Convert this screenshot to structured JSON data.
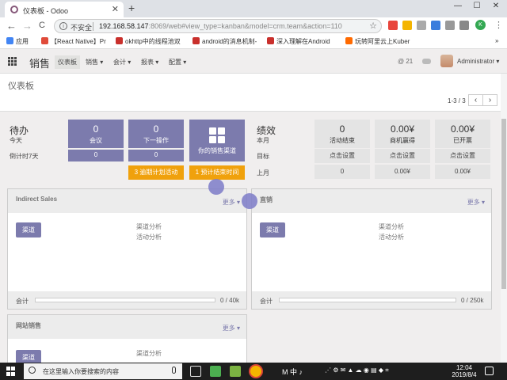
{
  "browser": {
    "tab_title": "仪表板 - Odoo",
    "tab_close": "✕",
    "new_tab": "+",
    "window_controls": [
      "—",
      "☐",
      "✕"
    ],
    "insecure_label": "不安全",
    "url_host": "192.168.58.147",
    "url_rest": ":8069/web#view_type=kanban&model=crm.team&action=110",
    "nav": {
      "back": "←",
      "forward": "→",
      "reload": "C"
    },
    "star": "☆",
    "profile_initial": "K",
    "menu_dots": "⋮",
    "bookmarks": [
      {
        "label": "应用",
        "color": "#4285f4"
      },
      {
        "label": "【React Native】Pr",
        "color": "#e04b3a"
      },
      {
        "label": "okhttp中的线程池双",
        "color": "#c9302c"
      },
      {
        "label": "android的消息机制-",
        "color": "#c9302c"
      },
      {
        "label": "深入理解在Android",
        "color": "#c9302c"
      },
      {
        "label": "玩转阿里云上Kuber",
        "color": "#ff6a00"
      }
    ],
    "bookmarks_more": "»"
  },
  "odoo": {
    "app_name": "销售",
    "menus": [
      {
        "label": "仪表板",
        "active": true
      },
      {
        "label": "销售 ▾",
        "active": false
      },
      {
        "label": "会计 ▾",
        "active": false
      },
      {
        "label": "报表 ▾",
        "active": false
      },
      {
        "label": "配置 ▾",
        "active": false
      }
    ],
    "messages": "@ 21",
    "user": "Administrator ▾"
  },
  "control_panel": {
    "breadcrumb": "仪表板",
    "pager": "1-3 / 3",
    "prev": "‹",
    "next": "›"
  },
  "dashboard": {
    "todo": {
      "title": "待办",
      "today": "今天",
      "next7": "倒计时7天",
      "meetings": {
        "num": "0",
        "label": "会议",
        "sub": "0"
      },
      "next_actions": {
        "num": "0",
        "label": "下一操作",
        "sub": "0"
      },
      "pipeline": {
        "label": "你的销售渠道"
      },
      "overdue_actions": "3 逾期计划活动",
      "overdue_close": "1 预计结束时间"
    },
    "performance": {
      "title": "绩效",
      "this_month": "本月",
      "target": "目标",
      "last_month": "上月",
      "columns": [
        {
          "num": "0",
          "label": "活动结束",
          "target": "点击设置",
          "last": "0"
        },
        {
          "num": "0.00¥",
          "label": "商机赢得",
          "target": "点击设置",
          "last": "0.00¥"
        },
        {
          "num": "0.00¥",
          "label": "已开票",
          "target": "点击设置",
          "last": "0.00¥"
        }
      ]
    }
  },
  "teams": [
    {
      "name": "Indirect Sales",
      "more": "更多 ▾",
      "button": "渠道",
      "links": [
        "渠道分析",
        "活动分析"
      ],
      "invoiced_label": "会计",
      "progress_text": "0 / 40k",
      "progress": 0
    },
    {
      "name": "直销",
      "more": "更多 ▾",
      "button": "渠道",
      "links": [
        "渠道分析",
        "活动分析"
      ],
      "invoiced_label": "会计",
      "progress_text": "0 / 250k",
      "progress": 0
    },
    {
      "name": "网站销售",
      "more": "更多 ▾",
      "button": "渠道",
      "links": [
        "渠道分析"
      ]
    }
  ],
  "taskbar": {
    "search_placeholder": "在这里输入你要搜索的内容",
    "tray_text": "M 中 ♪",
    "time": "12:04",
    "date": "2019/8/4"
  },
  "colors": {
    "odoo_purple": "#7c7bad",
    "odoo_orange": "#f0a10c"
  }
}
